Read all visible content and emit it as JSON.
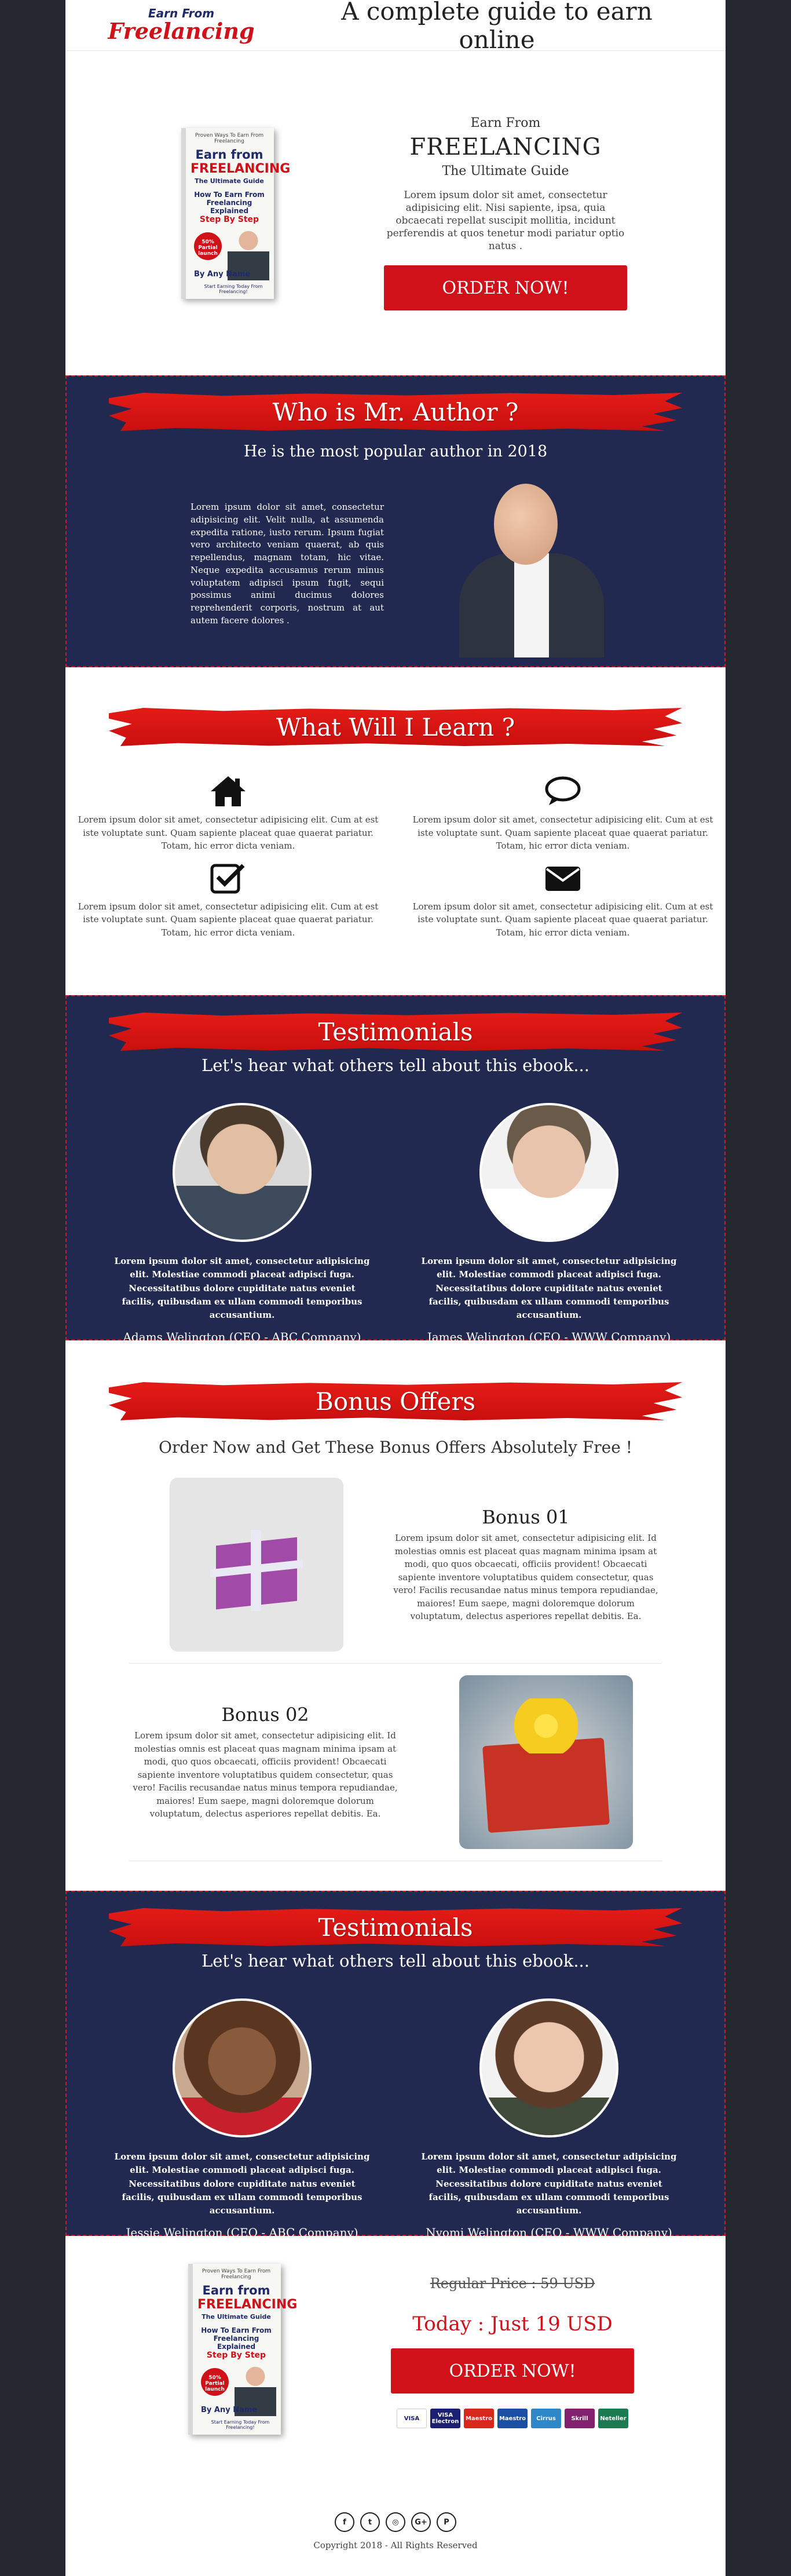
{
  "header": {
    "logo_top": "Earn From",
    "logo_bottom": "Freelancing",
    "title": "A complete guide to earn online"
  },
  "book": {
    "pre": "Proven Ways To Earn From Freelancing",
    "title1": "Earn from",
    "title2": "FREELANCING",
    "title3": "The Ultimate Guide",
    "title4": "How To Earn From Freelancing Explained",
    "title5": "Step By Step",
    "seal": "50% Partial launch",
    "author": "By Any Name",
    "foot": "Start Earning Today From Freelancing!"
  },
  "hero": {
    "line1": "Earn From",
    "line2": "FREELANCING",
    "line3": "The Ultimate Guide",
    "desc": "Lorem ipsum dolor sit amet, consectetur adipisicing elit. Nisi sapiente, ipsa, quia obcaecati repellat suscipit mollitia, incidunt perferendis at quos tenetur modi pariatur optio natus .",
    "order_label": "ORDER NOW!"
  },
  "who": {
    "heading": "Who is Mr. Author ?",
    "subheading": "He is the most popular author in 2018",
    "text": "Lorem ipsum dolor sit amet, consectetur adipisicing elit. Velit nulla, at assumenda expedita ratione, iusto rerum. Ipsum fugiat vero architecto veniam quaerat, ab quis repellendus, magnam totam, hic vitae. Neque expedita accusamus rerum minus voluptatem adipisci ipsum fugit, sequi possimus animi ducimus dolores reprehenderit corporis, nostrum at aut autem facere dolores ."
  },
  "learn": {
    "heading": "What Will I Learn ?",
    "items": [
      {
        "icon": "home-icon",
        "text": "Lorem ipsum dolor sit amet, consectetur adipisicing elit. Cum at est iste voluptate sunt. Quam sapiente placeat quae quaerat pariatur. Totam, hic error dicta veniam."
      },
      {
        "icon": "chat-icon",
        "text": "Lorem ipsum dolor sit amet, consectetur adipisicing elit. Cum at est iste voluptate sunt. Quam sapiente placeat quae quaerat pariatur. Totam, hic error dicta veniam."
      },
      {
        "icon": "checkbox-icon",
        "text": "Lorem ipsum dolor sit amet, consectetur adipisicing elit. Cum at est iste voluptate sunt. Quam sapiente placeat quae quaerat pariatur. Totam, hic error dicta veniam."
      },
      {
        "icon": "envelope-icon",
        "text": "Lorem ipsum dolor sit amet, consectetur adipisicing elit. Cum at est iste voluptate sunt. Quam sapiente placeat quae quaerat pariatur. Totam, hic error dicta veniam."
      }
    ]
  },
  "testimonials1": {
    "heading": "Testimonials",
    "subheading": "Let's hear what others tell about this ebook...",
    "items": [
      {
        "text": "Lorem ipsum dolor sit amet, consectetur adipisicing elit. Molestiae commodi placeat adipisci fuga. Necessitatibus dolore cupiditate natus eveniet facilis, quibusdam ex ullam commodi temporibus accusantium.",
        "name": "Adams Welington (CEO - ABC Company)"
      },
      {
        "text": "Lorem ipsum dolor sit amet, consectetur adipisicing elit. Molestiae commodi placeat adipisci fuga. Necessitatibus dolore cupiditate natus eveniet facilis, quibusdam ex ullam commodi temporibus accusantium.",
        "name": "James Welington (CEO - WWW Company)"
      }
    ]
  },
  "bonus": {
    "heading": "Bonus Offers",
    "subheading": "Order Now and Get These Bonus Offers Absolutely Free !",
    "items": [
      {
        "title": "Bonus 01",
        "text": "Lorem ipsum dolor sit amet, consectetur adipisicing elit. Id molestias omnis est placeat quas magnam minima ipsam at modi, quo quos obcaecati, officiis provident! Obcaecati sapiente inventore voluptatibus quidem consectetur, quas vero! Facilis recusandae natus minus tempora repudiandae, maiores! Eum saepe, magni doloremque dolorum voluptatum, delectus asperiores repellat debitis. Ea."
      },
      {
        "title": "Bonus 02",
        "text": "Lorem ipsum dolor sit amet, consectetur adipisicing elit. Id molestias omnis est placeat quas magnam minima ipsam at modi, quo quos obcaecati, officiis provident! Obcaecati sapiente inventore voluptatibus quidem consectetur, quas vero! Facilis recusandae natus minus tempora repudiandae, maiores! Eum saepe, magni doloremque dolorum voluptatum, delectus asperiores repellat debitis. Ea."
      }
    ]
  },
  "testimonials2": {
    "heading": "Testimonials",
    "subheading": "Let's hear what others tell about this ebook...",
    "items": [
      {
        "text": "Lorem ipsum dolor sit amet, consectetur adipisicing elit. Molestiae commodi placeat adipisci fuga. Necessitatibus dolore cupiditate natus eveniet facilis, quibusdam ex ullam commodi temporibus accusantium.",
        "name": "Jessie Welington (CEO - ABC Company)"
      },
      {
        "text": "Lorem ipsum dolor sit amet, consectetur adipisicing elit. Molestiae commodi placeat adipisci fuga. Necessitatibus dolore cupiditate natus eveniet facilis, quibusdam ex ullam commodi temporibus accusantium.",
        "name": "Nyomi Welington (CEO - WWW Company)"
      }
    ]
  },
  "final": {
    "regular": "Regular Price : 59 USD",
    "today": "Today : Just 19 USD",
    "order_label": "ORDER NOW!",
    "payments": [
      "VISA",
      "VISA Electron",
      "Maestro",
      "Maestro",
      "Cirrus",
      "Skrill",
      "Neteller"
    ]
  },
  "footer": {
    "social": [
      "facebook-icon",
      "twitter-icon",
      "instagram-icon",
      "google-plus-icon",
      "pinterest-icon"
    ],
    "copyright": "Copyright 2018 - All Rights Reserved"
  },
  "colors": {
    "accent": "#d0111a",
    "navy": "#222951",
    "background": "#24272d"
  }
}
